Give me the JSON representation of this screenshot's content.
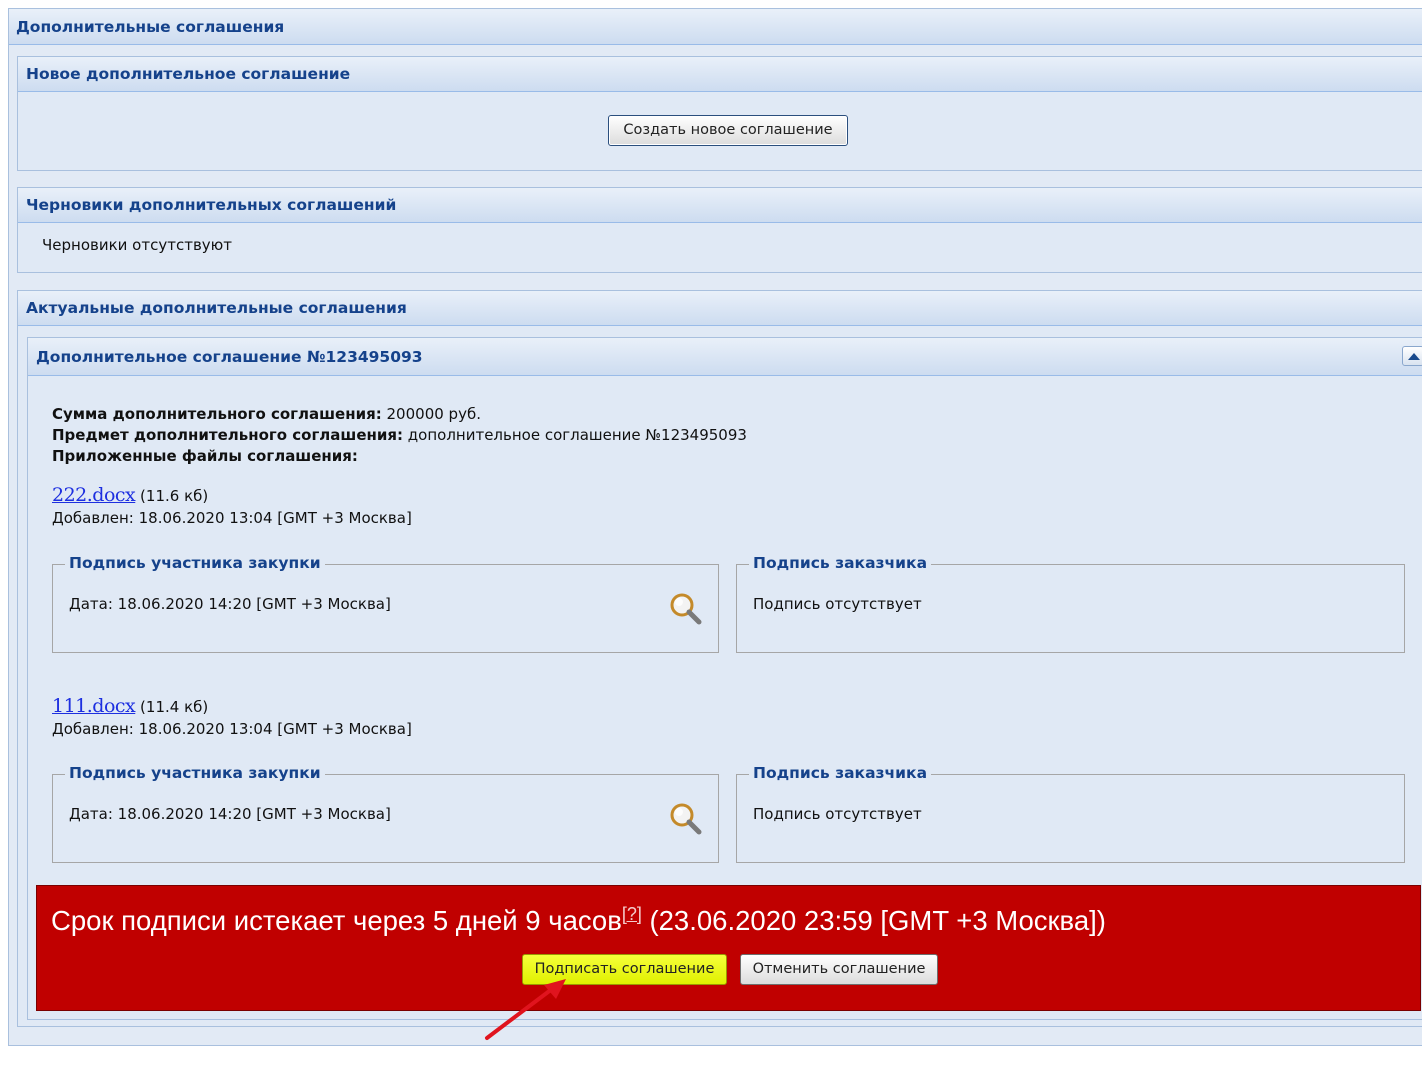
{
  "page_title": "Дополнительные соглашения",
  "new_section": {
    "title": "Новое дополнительное соглашение",
    "create_button": "Создать новое соглашение"
  },
  "drafts_section": {
    "title": "Черновики дополнительных соглашений",
    "empty_text": "Черновики отсутствуют"
  },
  "actual_section": {
    "title": "Актуальные дополнительные соглашения",
    "agreement": {
      "title": "Дополнительное соглашение №123495093",
      "sum_label": "Сумма дополнительного соглашения:",
      "sum_value": "200000 руб.",
      "subject_label": "Предмет дополнительного соглашения:",
      "subject_value": "дополнительное соглашение №123495093",
      "files_label": "Приложенные файлы соглашения:",
      "files": [
        {
          "name": "222.docx",
          "size": "(11.6 кб)",
          "added": "Добавлен: 18.06.2020 13:04 [GMT +3 Москва]",
          "participant_legend": "Подпись участника закупки",
          "participant_text": "Дата: 18.06.2020 14:20 [GMT +3 Москва]",
          "customer_legend": "Подпись заказчика",
          "customer_text": "Подпись отсутствует"
        },
        {
          "name": "111.docx",
          "size": "(11.4 кб)",
          "added": "Добавлен: 18.06.2020 13:04 [GMT +3 Москва]",
          "participant_legend": "Подпись участника закупки",
          "participant_text": "Дата: 18.06.2020 14:20 [GMT +3 Москва]",
          "customer_legend": "Подпись заказчика",
          "customer_text": "Подпись отсутствует"
        }
      ],
      "deadline": {
        "text": "Срок подписи истекает через 5 дней 9 часов",
        "help": "[?]",
        "date": " (23.06.2020 23:59 [GMT +3 Москва])",
        "sign_button": "Подписать соглашение",
        "cancel_button": "Отменить соглашение"
      }
    }
  },
  "icons": {
    "magnifier": "magnifier-icon",
    "collapse": "collapse-up-icon",
    "annotation": "red-arrow-annotation"
  },
  "colors": {
    "header_text": "#15428b",
    "deadline_bg": "#c00000",
    "sign_button_bg": "#e8f800",
    "link": "#1d2fe0",
    "arrow": "#e0141e"
  }
}
